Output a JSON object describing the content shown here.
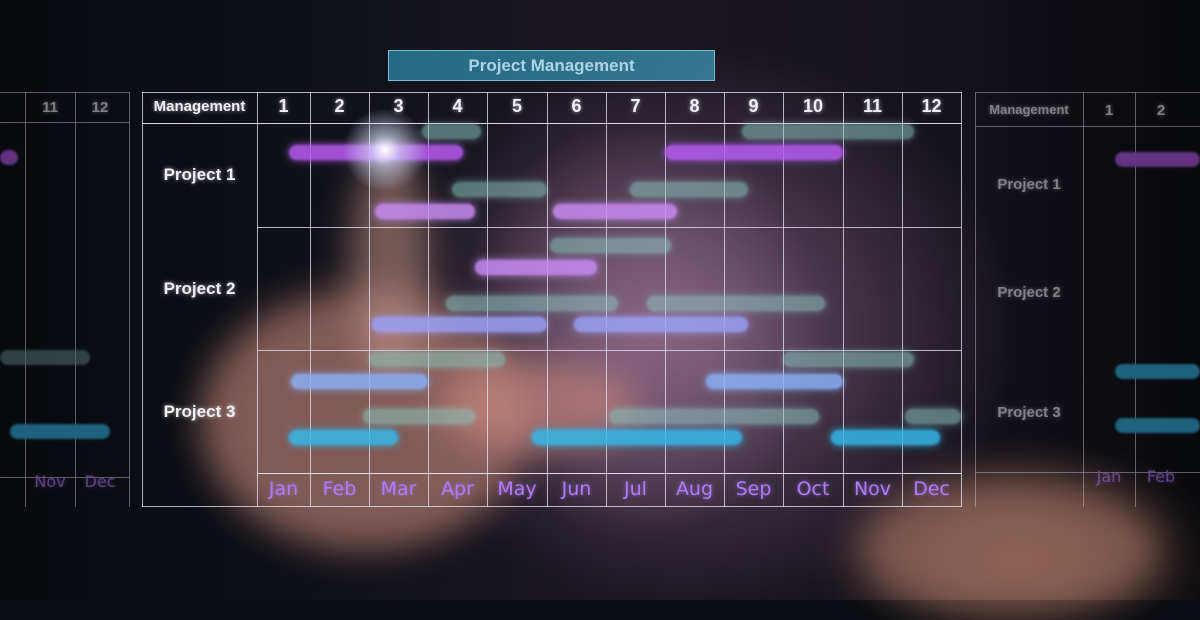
{
  "chart_data": {
    "type": "gantt",
    "title": "Project Management",
    "corner_label": "Management",
    "column_numbers": [
      "1",
      "2",
      "3",
      "4",
      "5",
      "6",
      "7",
      "8",
      "9",
      "10",
      "11",
      "12"
    ],
    "months": [
      "Jan",
      "Feb",
      "Mar",
      "Apr",
      "May",
      "Jun",
      "Jul",
      "Aug",
      "Sep",
      "Oct",
      "Nov",
      "Dec"
    ],
    "rows": [
      {
        "label": "Project 1",
        "bars": [
          {
            "lane": 0,
            "start": 2.9,
            "end": 3.9,
            "color": "teal"
          },
          {
            "lane": 0,
            "start": 8.3,
            "end": 11.2,
            "color": "teal"
          },
          {
            "lane": 1,
            "start": 0.6,
            "end": 3.6,
            "color": "purple"
          },
          {
            "lane": 1,
            "start": 7.0,
            "end": 10.0,
            "color": "purple"
          },
          {
            "lane": 2,
            "start": 3.4,
            "end": 5.0,
            "color": "teal"
          },
          {
            "lane": 2,
            "start": 6.4,
            "end": 8.4,
            "color": "teal"
          },
          {
            "lane": 3,
            "start": 2.1,
            "end": 3.8,
            "color": "lavender"
          },
          {
            "lane": 3,
            "start": 5.1,
            "end": 7.2,
            "color": "lavender"
          }
        ]
      },
      {
        "label": "Project 2",
        "bars": [
          {
            "lane": 0,
            "start": 5.05,
            "end": 7.1,
            "color": "teal"
          },
          {
            "lane": 1,
            "start": 3.8,
            "end": 5.85,
            "color": "lavender"
          },
          {
            "lane": 2,
            "start": 3.3,
            "end": 6.2,
            "color": "teal"
          },
          {
            "lane": 2,
            "start": 6.7,
            "end": 9.7,
            "color": "teal"
          },
          {
            "lane": 3,
            "start": 2.05,
            "end": 5.0,
            "color": "periwinkle"
          },
          {
            "lane": 3,
            "start": 5.45,
            "end": 8.4,
            "color": "periwinkle"
          }
        ]
      },
      {
        "label": "Project 3",
        "bars": [
          {
            "lane": 0,
            "start": 2.0,
            "end": 4.3,
            "color": "teal"
          },
          {
            "lane": 0,
            "start": 9.0,
            "end": 11.2,
            "color": "teal"
          },
          {
            "lane": 1,
            "start": 0.65,
            "end": 3.0,
            "color": "blue"
          },
          {
            "lane": 1,
            "start": 7.7,
            "end": 10.0,
            "color": "blue"
          },
          {
            "lane": 2,
            "start": 1.9,
            "end": 3.8,
            "color": "teal"
          },
          {
            "lane": 2,
            "start": 6.05,
            "end": 9.6,
            "color": "teal"
          },
          {
            "lane": 2,
            "start": 11.05,
            "end": 12.0,
            "color": "teal"
          },
          {
            "lane": 3,
            "start": 0.6,
            "end": 2.5,
            "color": "cyan"
          },
          {
            "lane": 3,
            "start": 4.75,
            "end": 8.3,
            "color": "cyan"
          },
          {
            "lane": 3,
            "start": 9.8,
            "end": 11.65,
            "color": "cyan"
          }
        ]
      }
    ],
    "colors": {
      "teal": "#8cc4bc",
      "purple": "#b85cf2",
      "lavender": "#c88cf4",
      "periwinkle": "#9aa0f6",
      "blue": "#8ab0f6",
      "cyan": "#34b8ea"
    }
  },
  "side_panels": {
    "left_numbers": [
      "11",
      "12"
    ],
    "left_months": [
      "Nov",
      "Dec"
    ],
    "right_corner": "Management",
    "right_numbers": [
      "1",
      "2"
    ],
    "right_rows": [
      "Project 1",
      "Project 2",
      "Project 3"
    ],
    "right_months": [
      "Jan",
      "Feb"
    ]
  }
}
